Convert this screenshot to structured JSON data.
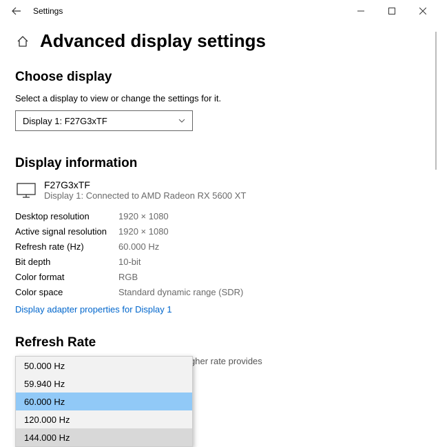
{
  "window": {
    "title": "Settings"
  },
  "page": {
    "heading": "Advanced display settings"
  },
  "choose": {
    "heading": "Choose display",
    "subtext": "Select a display to view or change the settings for it.",
    "selected": "Display 1: F27G3xTF"
  },
  "info": {
    "heading": "Display information",
    "monitor_name": "F27G3xTF",
    "monitor_sub": "Display 1: Connected to AMD Radeon RX 5600 XT",
    "rows": [
      {
        "label": "Desktop resolution",
        "value": "1920 × 1080"
      },
      {
        "label": "Active signal resolution",
        "value": "1920 × 1080"
      },
      {
        "label": "Refresh rate (Hz)",
        "value": "60.000 Hz"
      },
      {
        "label": "Bit depth",
        "value": "10-bit"
      },
      {
        "label": "Color format",
        "value": "RGB"
      },
      {
        "label": "Color space",
        "value": "Standard dynamic range (SDR)"
      }
    ],
    "link": "Display adapter properties for Display 1"
  },
  "refresh": {
    "heading": "Refresh Rate",
    "partial": "gher rate provides",
    "options": [
      {
        "label": "50.000 Hz",
        "state": ""
      },
      {
        "label": "59.940 Hz",
        "state": ""
      },
      {
        "label": "60.000 Hz",
        "state": "selected"
      },
      {
        "label": "120.000 Hz",
        "state": ""
      },
      {
        "label": "144.000 Hz",
        "state": "hover"
      }
    ]
  }
}
